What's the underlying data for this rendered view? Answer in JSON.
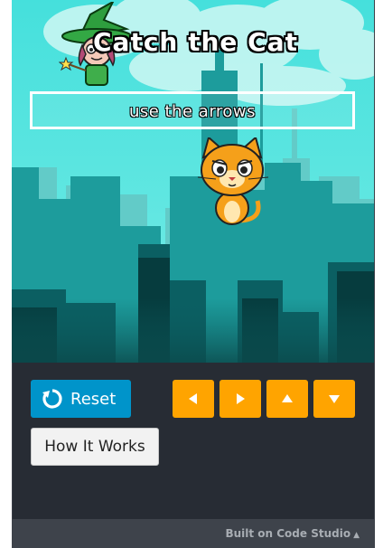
{
  "game": {
    "title": "Catch the Cat",
    "hint": "use the arrows"
  },
  "controls": {
    "reset_label": "Reset",
    "how_label": "How It Works",
    "arrows": [
      "left",
      "right",
      "up",
      "down"
    ]
  },
  "footer": {
    "text": "Built on Code Studio",
    "caret": "▲"
  },
  "colors": {
    "sky": "#5fe6e1",
    "reset_button": "#0094ca",
    "arrow_button": "#ffa400",
    "panel": "#272c34",
    "footer": "#3e434b"
  }
}
